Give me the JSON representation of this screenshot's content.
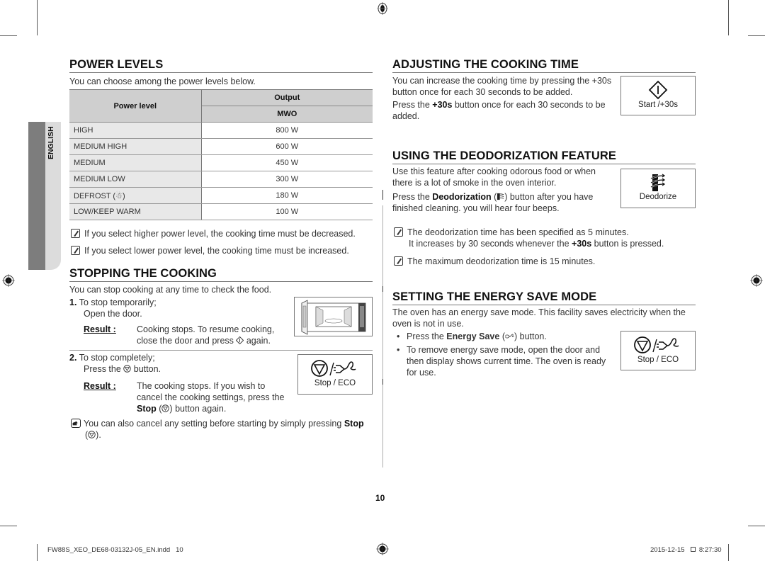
{
  "page_number": "10",
  "sidebar_tab": {
    "label": "ENGLISH"
  },
  "left": {
    "power_levels": {
      "title": "POWER LEVELS",
      "intro": "You can choose among the power levels below.",
      "table": {
        "col_power_level": "Power level",
        "col_output": "Output",
        "col_mwo": "MWO",
        "rows": [
          {
            "level": "HIGH",
            "output": "800 W"
          },
          {
            "level": "MEDIUM HIGH",
            "output": "600 W"
          },
          {
            "level": "MEDIUM",
            "output": "450 W"
          },
          {
            "level": "MEDIUM LOW",
            "output": "300 W"
          },
          {
            "level": "DEFROST (☃)",
            "output": "180 W"
          },
          {
            "level": "LOW/KEEP WARM",
            "output": "100 W"
          }
        ]
      },
      "notes": [
        "If you select higher power level, the cooking time must be decreased.",
        "If you select lower power level, the cooking time must be increased."
      ]
    },
    "stopping": {
      "title": "STOPPING THE COOKING",
      "intro": "You can stop cooking at any time to check the food.",
      "step1": {
        "num": "1.",
        "line1": "To stop temporarily;",
        "line2": "Open the door.",
        "result_label": "Result :",
        "result_line1": "Cooking stops. To resume cooking,",
        "result_line2_pre": "close the door and press",
        "result_line2_post": "again."
      },
      "step2": {
        "num": "2.",
        "line1": "To stop completely;",
        "line2_pre": "Press the",
        "line2_post": "button.",
        "result_label": "Result :",
        "result_line1": "The cooking stops. If you wish to",
        "result_line2": "cancel the cooking settings, press the",
        "result_line3_bold": "Stop",
        "result_line3_post": "button again."
      },
      "stop_button_label": "Stop / ECO",
      "tip_pre": "You can also cancel any setting before starting by simply pressing",
      "tip_bold": "Stop",
      "tip_end": ")."
    }
  },
  "right": {
    "adjusting": {
      "title": "ADJUSTING THE COOKING TIME",
      "p1_line1": "You can increase the cooking time by pressing the +30s",
      "p1_line2": "button once for each 30 seconds to be added.",
      "p2_pre": "Press the",
      "p2_bold": "+30s",
      "p2_post": "button once for each 30 seconds to be",
      "p2_line2": "added.",
      "button_label": "Start /+30s"
    },
    "deodorization": {
      "title": "USING THE DEODORIZATION FEATURE",
      "p1_line1": "Use this feature after cooking odorous food or when",
      "p1_line2": "there is a lot of smoke in the oven interior.",
      "p2_pre": "Press the",
      "p2_bold": "Deodorization",
      "p2_post": "button after you have",
      "p2_line2": "finished cleaning. you will hear four beeps.",
      "button_label": "Deodorize",
      "note1_line1": "The deodorization time has been specified as 5 minutes.",
      "note1_line2_pre": "It increases by 30 seconds whenever the",
      "note1_line2_bold": "+30s",
      "note1_line2_post": "button is pressed.",
      "note2": "The maximum deodorization time is 15 minutes."
    },
    "energy_save": {
      "title": "SETTING THE ENERGY SAVE MODE",
      "p1_line1": "The oven has an energy save mode. This facility saves electricity when the",
      "p1_line2": "oven is not in use.",
      "b1_pre": "Press the",
      "b1_bold": "Energy Save",
      "b1_post": "button.",
      "b2_line1": "To remove energy save mode, open the door and",
      "b2_line2": "then display shows current time. The oven is ready",
      "b2_line3": "for use.",
      "button_label": "Stop / ECO"
    }
  },
  "footer": {
    "file": "FW88S_XEO_DE68-03132J-05_EN.indd   10",
    "date": "2015-12-15",
    "time": "8:27:30"
  }
}
